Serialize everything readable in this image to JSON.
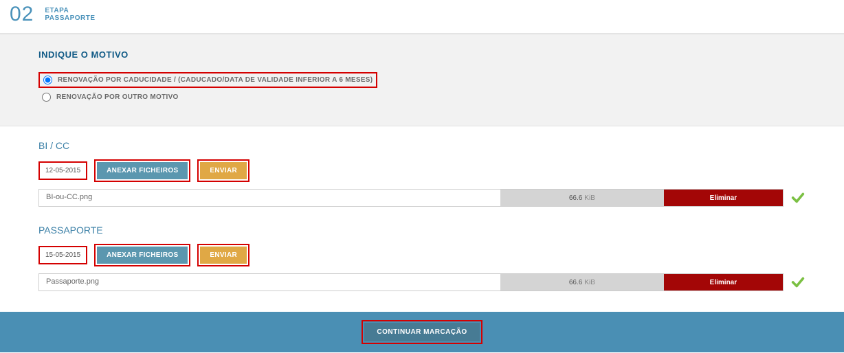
{
  "step": {
    "number": "02",
    "label_top": "ETAPA",
    "label_bot": "PASSAPORTE"
  },
  "motivo": {
    "title": "INDIQUE O MOTIVO",
    "options": [
      "RENOVAÇÃO POR CADUCIDADE / (CADUCADO/DATA DE VALIDADE INFERIOR A 6 MESES)",
      "RENOVAÇÃO POR OUTRO MOTIVO"
    ]
  },
  "docs": [
    {
      "title": "BI / CC",
      "date": "12-05-2015",
      "btn_attach": "ANEXAR FICHEIROS",
      "btn_send": "ENVIAR",
      "file_name": "BI-ou-CC.png",
      "file_size": "66.6",
      "file_unit": "KiB",
      "btn_delete": "Eliminar"
    },
    {
      "title": "PASSAPORTE",
      "date": "15-05-2015",
      "btn_attach": "ANEXAR FICHEIROS",
      "btn_send": "ENVIAR",
      "file_name": "Passaporte.png",
      "file_size": "66.6",
      "file_unit": "KiB",
      "btn_delete": "Eliminar"
    }
  ],
  "footer": {
    "continue": "CONTINUAR MARCAÇÃO"
  }
}
